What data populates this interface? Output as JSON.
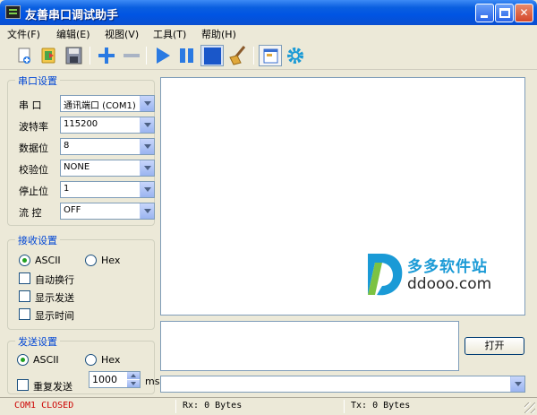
{
  "window": {
    "title": "友善串口调试助手"
  },
  "menu": [
    {
      "label": "文件(F)"
    },
    {
      "label": "编辑(E)"
    },
    {
      "label": "视图(V)"
    },
    {
      "label": "工具(T)"
    },
    {
      "label": "帮助(H)"
    }
  ],
  "toolbar": {
    "icons": [
      "new-icon",
      "open-icon",
      "save-icon",
      "add-icon",
      "remove-icon",
      "play-icon",
      "pause-icon",
      "stop-icon",
      "clear-icon",
      "window-icon",
      "settings-icon"
    ]
  },
  "serial": {
    "title": "串口设置",
    "fields": [
      {
        "label": "串  口",
        "value": "通讯端口 (COM1)"
      },
      {
        "label": "波特率",
        "value": "115200"
      },
      {
        "label": "数据位",
        "value": "8"
      },
      {
        "label": "校验位",
        "value": "NONE"
      },
      {
        "label": "停止位",
        "value": "1"
      },
      {
        "label": "流  控",
        "value": "OFF"
      }
    ]
  },
  "receive": {
    "title": "接收设置",
    "mode_ascii": "ASCII",
    "mode_hex": "Hex",
    "selected_mode": "ASCII",
    "options": [
      {
        "label": "自动换行",
        "checked": false
      },
      {
        "label": "显示发送",
        "checked": false
      },
      {
        "label": "显示时间",
        "checked": false
      }
    ]
  },
  "send": {
    "title": "发送设置",
    "mode_ascii": "ASCII",
    "mode_hex": "Hex",
    "selected_mode": "ASCII",
    "repeat_label": "重复发送",
    "repeat_checked": false,
    "interval": "1000",
    "interval_unit": "ms",
    "open_button": "打开"
  },
  "watermark": {
    "name": "多多软件站",
    "url": "ddooo.com"
  },
  "status": {
    "port": "COM1 CLOSED",
    "rx": "Rx: 0 Bytes",
    "tx": "Tx: 0 Bytes",
    "port_color": "#cc0000"
  },
  "colors": {
    "titlebar": "#0054e3",
    "group_label": "#0046d5",
    "accent": "#1a9ad6"
  }
}
